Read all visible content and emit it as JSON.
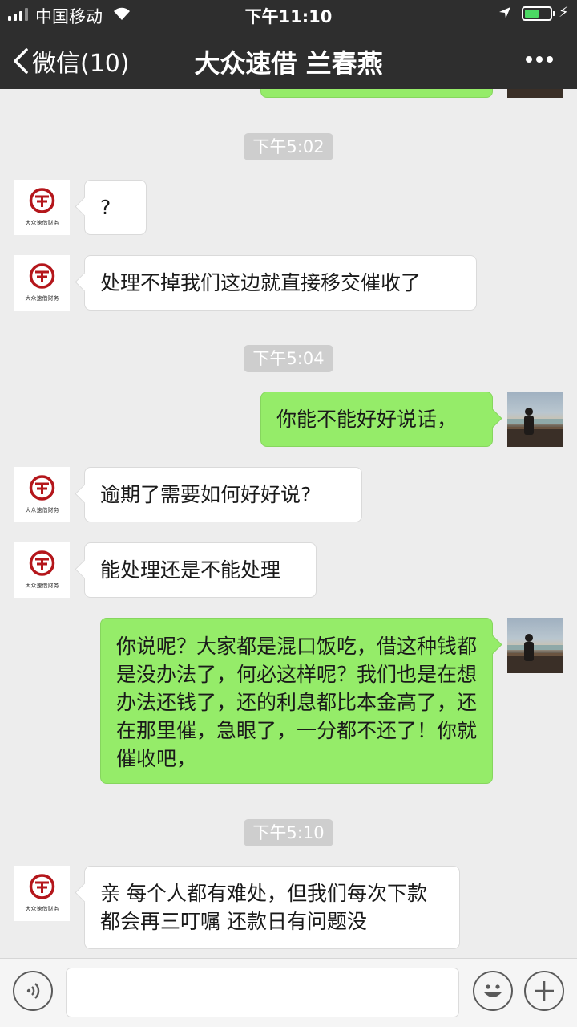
{
  "status_bar": {
    "carrier": "中国移动",
    "time": "下午11:10",
    "wifi_icon": "wifi-icon",
    "location_icon": "location-arrow-icon",
    "battery_icon": "battery-icon",
    "battery_level": 0.55,
    "battery_color": "#4cd964",
    "charging_icon": "charging-bolt-icon"
  },
  "nav": {
    "back_label": "微信(10)",
    "title": "大众速借 兰春燕",
    "more_icon": "more-icon"
  },
  "brand_avatar_text": "大众速借财务",
  "timestamps": [
    "下午5:02",
    "下午5:04",
    "下午5:10"
  ],
  "messages": [
    {
      "side": "left",
      "text": "?"
    },
    {
      "side": "left",
      "text": "处理不掉我们这边就直接移交催收了"
    },
    {
      "side": "right",
      "text": "你能不能好好说话，"
    },
    {
      "side": "left",
      "text": "逾期了需要如何好好说?"
    },
    {
      "side": "left",
      "text": "能处理还是不能处理"
    },
    {
      "side": "right",
      "text": "你说呢？大家都是混口饭吃，借这种钱都是没办法了，何必这样呢？我们也是在想办法还钱了，还的利息都比本金高了，还在那里催，急眼了，一分都不还了！你就催收吧，"
    },
    {
      "side": "left",
      "text": "亲 每个人都有难处，但我们每次下款都会再三叮嘱 还款日有问题没"
    }
  ],
  "input_bar": {
    "voice_icon": "voice-icon",
    "emoji_icon": "emoji-icon",
    "plus_icon": "plus-icon",
    "text_value": ""
  },
  "colors": {
    "nav_bg": "#2e2e2e",
    "chat_bg": "#ededed",
    "outgoing_bubble": "#95ec69",
    "incoming_bubble": "#ffffff",
    "brand_red": "#b4161b"
  }
}
